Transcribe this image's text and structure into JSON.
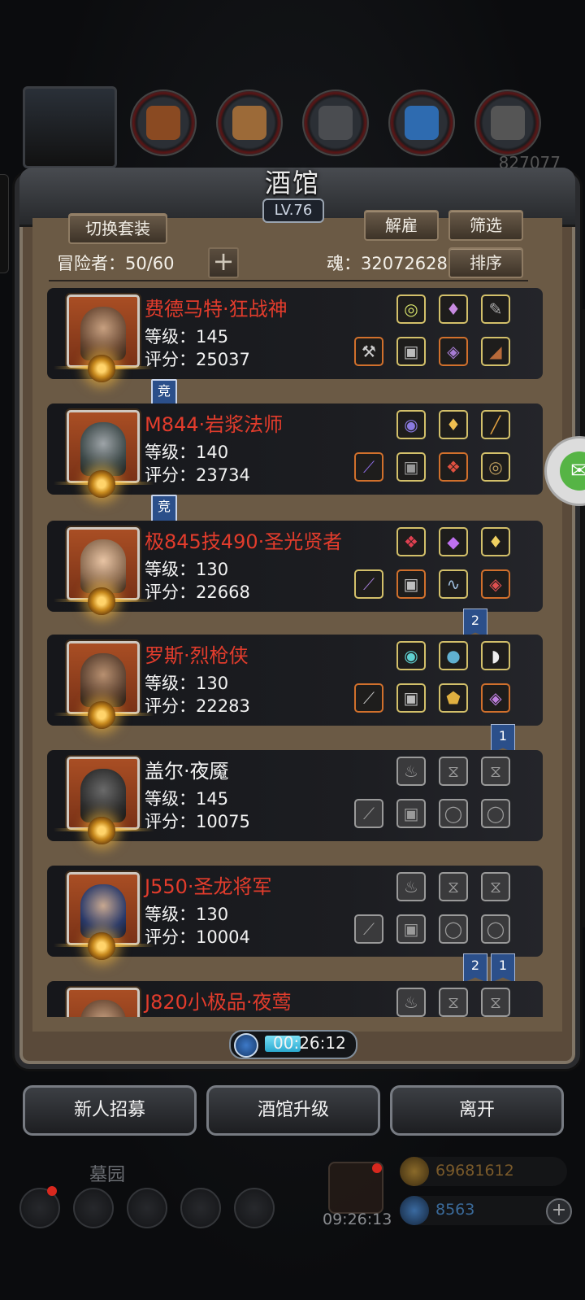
{
  "header": {
    "title": "酒馆",
    "level": "LV.76",
    "hidden_resource": "827077"
  },
  "toolbar": {
    "switch_set": "切换套装",
    "dismiss": "解雇",
    "filter": "筛选",
    "sort": "排序",
    "adventurers_label": "冒险者：50/60",
    "soul_label": "魂：32072628",
    "add_symbol": "+"
  },
  "heroes": [
    {
      "name": "费德马特·狂战神",
      "level": "等级：145",
      "score": "评分：25037",
      "name_color": "red",
      "tag": "竞"
    },
    {
      "name": "M844·岩浆法师",
      "level": "等级：140",
      "score": "评分：23734",
      "name_color": "red",
      "tag": "竞"
    },
    {
      "name": "极845技490·圣光贤者",
      "level": "等级：130",
      "score": "评分：22668",
      "name_color": "red",
      "tag": "2"
    },
    {
      "name": "罗斯·烈枪侠",
      "level": "等级：130",
      "score": "评分：22283",
      "name_color": "red",
      "tag": "1"
    },
    {
      "name": "盖尔·夜魇",
      "level": "等级：145",
      "score": "评分：10075",
      "name_color": "white",
      "tag": ""
    },
    {
      "name": "J550·圣龙将军",
      "level": "等级：130",
      "score": "评分：10004",
      "name_color": "red",
      "tags": [
        "2",
        "1"
      ]
    },
    {
      "name": "J820小极品·夜莺",
      "level": "",
      "score": "",
      "name_color": "red",
      "tag": ""
    }
  ],
  "timer": {
    "value": "00:26:12"
  },
  "actions": {
    "recruit": "新人招募",
    "upgrade": "酒馆升级",
    "leave": "离开"
  },
  "bottom": {
    "graveyard": "墓园",
    "gift_timer": "09:26:13",
    "gold": "69681612",
    "gems": "8563"
  },
  "colors": {
    "name_red": "#e23c2c",
    "gold_border": "#d3c06a",
    "orange_border": "#d1702c"
  }
}
